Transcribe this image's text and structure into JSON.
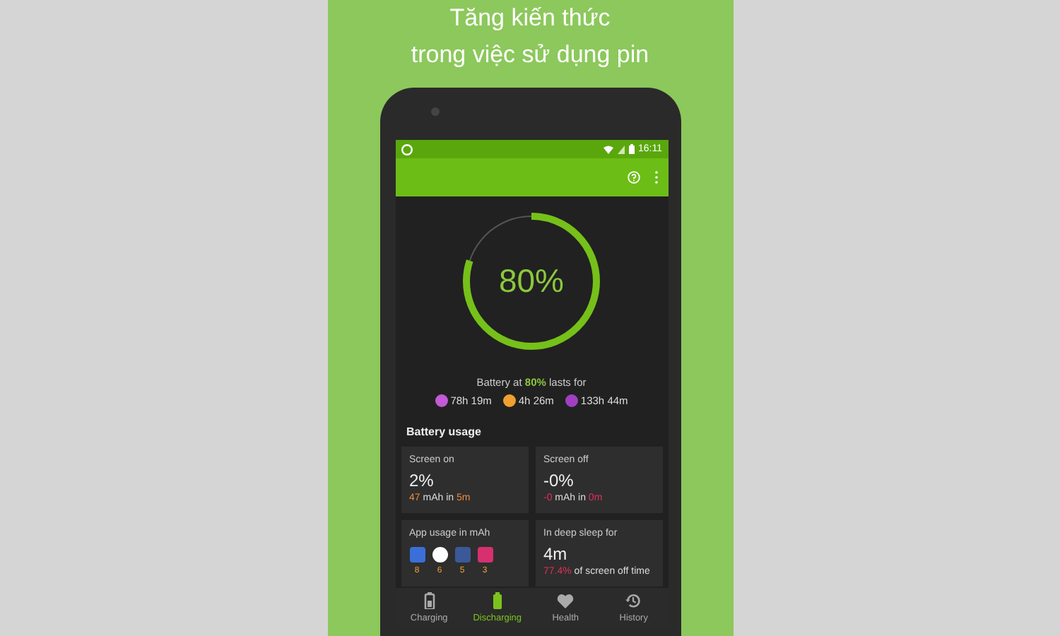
{
  "headline": [
    "Tăng kiến thức",
    "trong việc sử dụng pin"
  ],
  "status_bar": {
    "time": "16:11"
  },
  "battery": {
    "level": 0.8,
    "percent": "80%",
    "summary": "Battery at **80%** lasts for",
    "estimates": [
      {
        "color": "#c45ad6",
        "time": "78h 19m"
      },
      {
        "color": "#f0a030",
        "time": "4h 26m"
      },
      {
        "color": "#a040c0",
        "time": "133h 44m"
      }
    ]
  },
  "usage": {
    "title": "Battery usage",
    "cards": [
      {
        "kind": "stat",
        "label": "Screen on",
        "value": "2%",
        "detail": "**47** mAh in **5m**",
        "color": "#f08a3c"
      },
      {
        "kind": "stat",
        "label": "Screen off",
        "value": "-0%",
        "detail": "**-0** mAh in **0m**",
        "color": "#e0305a"
      },
      {
        "kind": "apps",
        "label": "App usage in mAh",
        "apps": [
          {
            "color": "#3b6fd8",
            "count": "8"
          },
          {
            "color": "#ffffff",
            "count": "6"
          },
          {
            "color": "#3b5998",
            "count": "5"
          },
          {
            "color": "#d6306f",
            "count": "3"
          }
        ]
      },
      {
        "kind": "stat",
        "label": "In deep sleep for",
        "value": "4m",
        "detail": "**77.4%** of screen off time",
        "color": "#e0305a"
      }
    ]
  },
  "nav": [
    {
      "label": "Charging",
      "selected": false
    },
    {
      "label": "Discharging",
      "selected": true
    },
    {
      "label": "Health",
      "selected": false
    },
    {
      "label": "History",
      "selected": false
    }
  ]
}
